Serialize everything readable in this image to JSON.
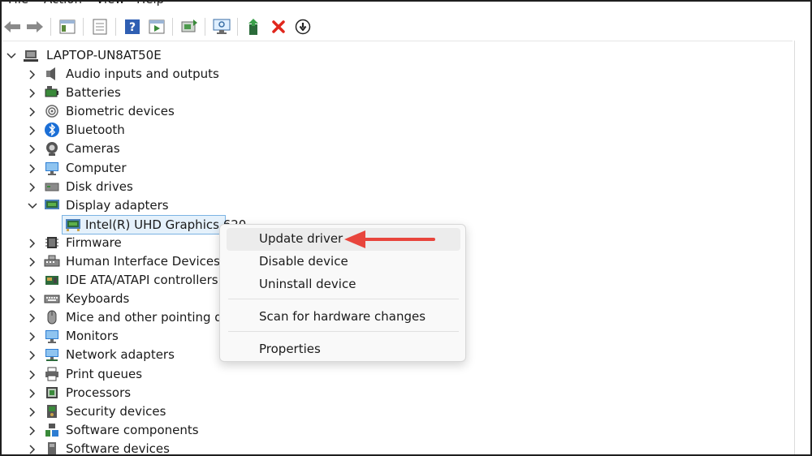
{
  "menu": {
    "items": [
      "File",
      "Action",
      "View",
      "Help"
    ]
  },
  "toolbar": {
    "buttons": [
      "back-arrow-icon",
      "forward-arrow-icon",
      "show-hide-console-tree-icon",
      "properties-icon",
      "help-icon",
      "show-action-pane-icon",
      "update-driver-toolbar-icon",
      "scan-hardware-icon",
      "enable-device-icon",
      "uninstall-icon",
      "disable-device-icon"
    ]
  },
  "tree": {
    "root": "LAPTOP-UN8AT50E",
    "categories": [
      {
        "label": "Audio inputs and outputs",
        "icon": "speaker-icon"
      },
      {
        "label": "Batteries",
        "icon": "battery-icon"
      },
      {
        "label": "Biometric devices",
        "icon": "fingerprint-icon"
      },
      {
        "label": "Bluetooth",
        "icon": "bluetooth-icon"
      },
      {
        "label": "Cameras",
        "icon": "camera-icon"
      },
      {
        "label": "Computer",
        "icon": "monitor-icon"
      },
      {
        "label": "Disk drives",
        "icon": "disk-drive-icon"
      },
      {
        "label": "Display adapters",
        "icon": "display-adapter-icon",
        "expanded": true
      },
      {
        "label": "Firmware",
        "icon": "chip-icon"
      },
      {
        "label": "Human Interface Devices",
        "icon": "hid-icon"
      },
      {
        "label": "IDE ATA/ATAPI controllers",
        "icon": "ide-controller-icon"
      },
      {
        "label": "Keyboards",
        "icon": "keyboard-icon"
      },
      {
        "label": "Mice and other pointing dev",
        "icon": "mouse-icon"
      },
      {
        "label": "Monitors",
        "icon": "monitor-icon"
      },
      {
        "label": "Network adapters",
        "icon": "network-icon"
      },
      {
        "label": "Print queues",
        "icon": "printer-icon"
      },
      {
        "label": "Processors",
        "icon": "processor-icon"
      },
      {
        "label": "Security devices",
        "icon": "security-icon"
      },
      {
        "label": "Software components",
        "icon": "software-component-icon"
      },
      {
        "label": "Software devices",
        "icon": "software-device-icon"
      }
    ],
    "selected_child": "Intel(R) UHD Graphics 620"
  },
  "context_menu": {
    "items": [
      "Update driver",
      "Disable device",
      "Uninstall device",
      "Scan for hardware changes",
      "Properties"
    ]
  },
  "colors": {
    "annotation_arrow": "#e8453c",
    "selection_bg": "#e5f1fb",
    "selection_border": "#7bb3e3"
  }
}
